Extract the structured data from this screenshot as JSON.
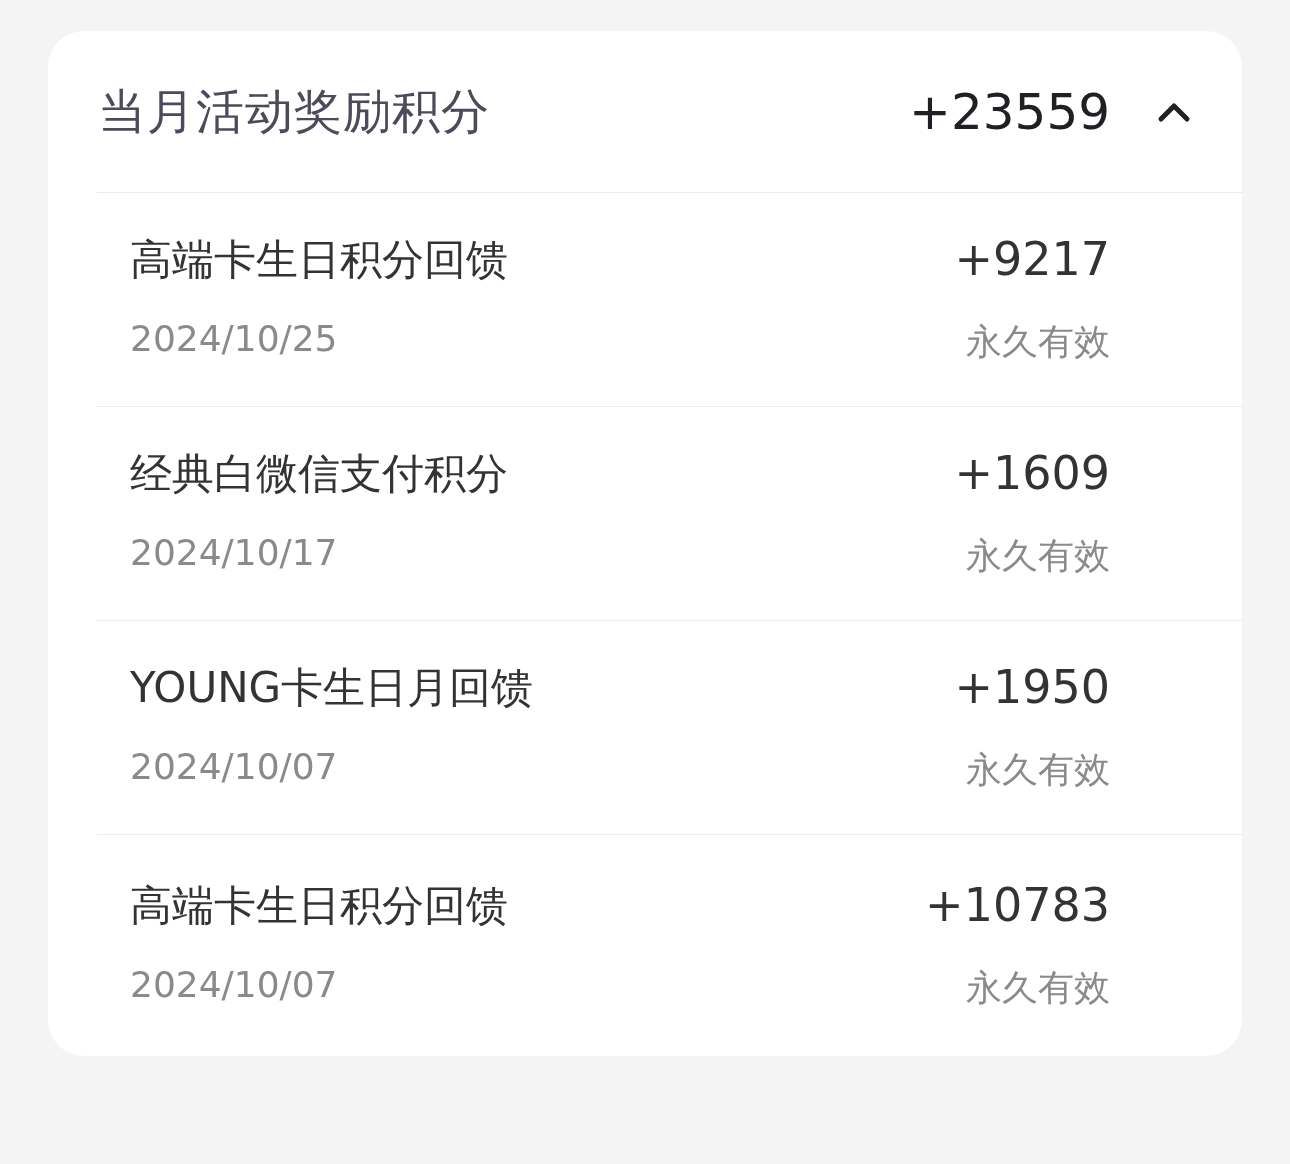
{
  "summary": {
    "title": "当月活动奖励积分",
    "total": "+23559",
    "expanded": true
  },
  "records": [
    {
      "title": "高端卡生日积分回馈",
      "amount": "+9217",
      "date": "2024/10/25",
      "validity": "永久有效"
    },
    {
      "title": "经典白微信支付积分",
      "amount": "+1609",
      "date": "2024/10/17",
      "validity": "永久有效"
    },
    {
      "title": "YOUNG卡生日月回馈",
      "amount": "+1950",
      "date": "2024/10/07",
      "validity": "永久有效"
    },
    {
      "title": "高端卡生日积分回馈",
      "amount": "+10783",
      "date": "2024/10/07",
      "validity": "永久有效"
    }
  ]
}
